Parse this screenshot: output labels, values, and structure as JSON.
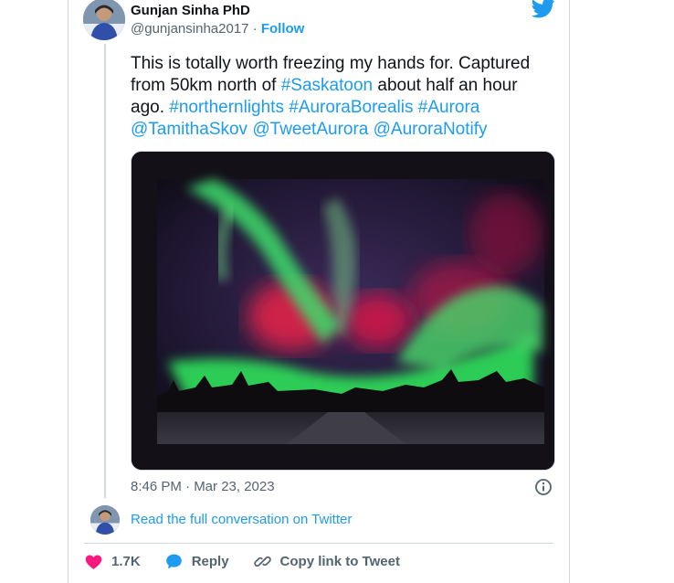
{
  "author": {
    "display_name": "Gunjan Sinha PhD",
    "handle": "@gunjansinha2017",
    "separator": " · ",
    "follow_label": "Follow"
  },
  "tweet": {
    "text_before": "This is totally worth freezing my hands for. Captured from 50km north of ",
    "hashtag_saskatoon": "#Saskatoon",
    "text_middle": " about half an hour ago. ",
    "hashtag_northernlights": "#northernlights",
    "hashtag_aurora_borealis": "#AuroraBorealis",
    "hashtag_aurora": "#Aurora",
    "mention_tamitha": "@TamithaSkov",
    "mention_tweetaurora": "@TweetAurora",
    "mention_auroranotify": "@AuroraNotify",
    "media_description": "Photo of green and red aurora borealis above a treeline and road"
  },
  "meta": {
    "timestamp": "8:46 PM · Mar 23, 2023"
  },
  "read_more_label": "Read the full conversation on Twitter",
  "actions": {
    "like_count": "1.7K",
    "reply_label": "Reply",
    "copy_label": "Copy link to Tweet"
  },
  "colors": {
    "link": "#1d9bf0",
    "like": "#f91880",
    "text": "#0f1419",
    "muted": "#536471"
  },
  "icons": [
    "twitter-bird-icon",
    "info-icon",
    "heart-icon",
    "reply-bubble-icon",
    "link-icon"
  ]
}
